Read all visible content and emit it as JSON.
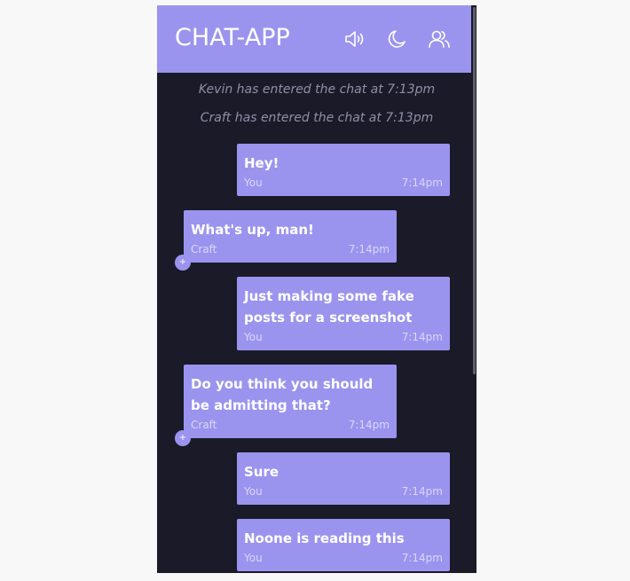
{
  "header": {
    "title": "CHAT-APP",
    "icons": [
      "sound-icon",
      "moon-icon",
      "users-icon"
    ]
  },
  "system_messages": [
    "Kevin has entered the chat at 7:13pm",
    "Craft has entered the chat at 7:13pm"
  ],
  "messages": [
    {
      "text": "Hey!",
      "author": "You",
      "time": "7:14pm",
      "side": "right"
    },
    {
      "text": "What's up, man!",
      "author": "Craft",
      "time": "7:14pm",
      "side": "left",
      "reaction": "+"
    },
    {
      "text": "Just making some fake posts for a screenshot",
      "author": "You",
      "time": "7:14pm",
      "side": "right"
    },
    {
      "text": "Do you think you should be admitting that?",
      "author": "Craft",
      "time": "7:14pm",
      "side": "left",
      "reaction": "+"
    },
    {
      "text": "Sure",
      "author": "You",
      "time": "7:14pm",
      "side": "right"
    },
    {
      "text": "Noone is reading this",
      "author": "You",
      "time": "7:14pm",
      "side": "right"
    }
  ],
  "colors": {
    "accent": "#9a94ee",
    "background": "#1b1a28",
    "system_text": "#8f8fa8"
  }
}
